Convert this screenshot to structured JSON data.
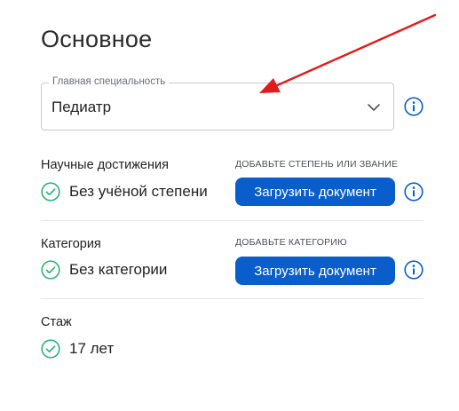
{
  "page_title": "Основное",
  "specialty": {
    "label": "Главная специальность",
    "value": "Педиатр"
  },
  "sections": [
    {
      "label": "Научные достижения",
      "hint": "ДОБАВЬТЕ СТЕПЕНЬ ИЛИ ЗВАНИЕ",
      "status": "Без учёной степени",
      "button": "Загрузить документ"
    },
    {
      "label": "Категория",
      "hint": "ДОБАВЬТЕ КАТЕГОРИЮ",
      "status": "Без категории",
      "button": "Загрузить документ"
    },
    {
      "label": "Стаж",
      "status": "17 лет"
    }
  ],
  "colors": {
    "accent": "#0a5ecc",
    "check": "#2bb37a",
    "annotation_arrow": "#e31b1b"
  },
  "icons": {
    "dropdown": "chevron-down-icon",
    "info": "info-icon",
    "check": "check-circle-icon"
  }
}
